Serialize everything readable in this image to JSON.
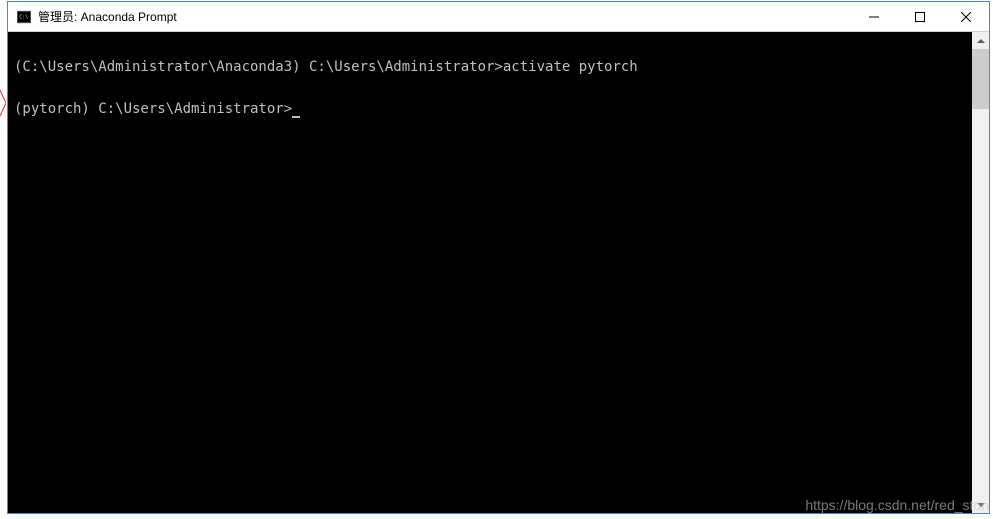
{
  "window": {
    "title": "管理员: Anaconda Prompt"
  },
  "terminal": {
    "line1_prefix": "(C:\\Users\\Administrator\\Anaconda3) C:\\Users\\Administrator>",
    "line1_cmd": "activate pytorch",
    "line2_prefix": "(pytorch) C:\\Users\\Administrator>"
  },
  "watermark": "https://blog.csdn.net/red_ston"
}
